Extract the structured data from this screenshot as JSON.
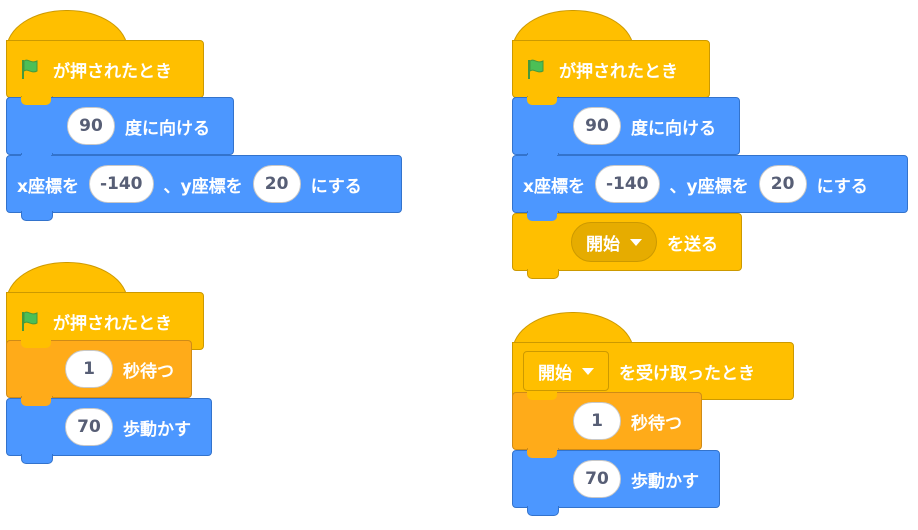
{
  "scripts": [
    {
      "hat": "が押されたとき",
      "blocks": [
        {
          "pre": "",
          "value": "90",
          "post": "度に向ける"
        },
        {
          "pre": "x座標を",
          "value": "-140",
          "mid": "、y座標を",
          "value2": "20",
          "post": "にする"
        }
      ]
    },
    {
      "hat": "が押されたとき",
      "blocks": [
        {
          "value": "1",
          "post": "秒待つ"
        },
        {
          "value": "70",
          "post": "歩動かす"
        }
      ]
    },
    {
      "hat": "が押されたとき",
      "blocks": [
        {
          "value": "90",
          "post": "度に向ける"
        },
        {
          "pre": "x座標を",
          "value": "-140",
          "mid": "、y座標を",
          "value2": "20",
          "post": "にする"
        },
        {
          "dropdown": "開始",
          "post": "を送る"
        }
      ]
    },
    {
      "hat_dropdown": "開始",
      "hat": "を受け取ったとき",
      "blocks": [
        {
          "value": "1",
          "post": "秒待つ"
        },
        {
          "value": "70",
          "post": "歩動かす"
        }
      ]
    }
  ],
  "icons": {
    "flag": "green-flag-icon",
    "caret": "dropdown-caret-icon"
  },
  "colors": {
    "motion": "#4c97ff",
    "control": "#ffab19",
    "events": "#ffbf00",
    "flag": "#4cbf56"
  }
}
